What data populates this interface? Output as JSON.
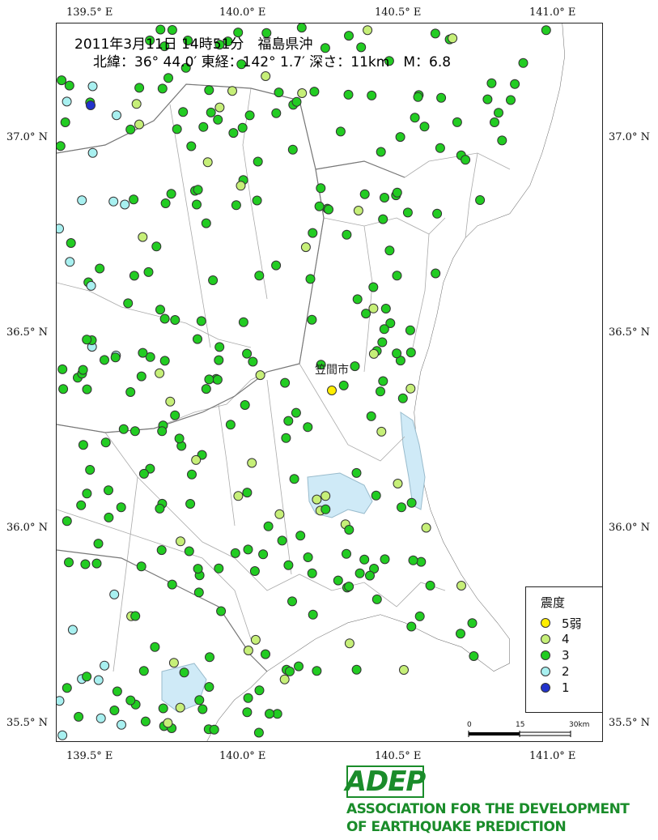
{
  "header": {
    "line1": "2011年3月11日 14時51分　福島県沖",
    "line2": "北緯：36° 44.0′ 東経：142° 1.7′ 深さ：11km　M：6.8"
  },
  "axes": {
    "top": [
      "139.5° E",
      "140.0° E",
      "140.5° E",
      "141.0° E"
    ],
    "bottom": [
      "139.5° E",
      "140.0° E",
      "140.5° E",
      "141.0° E"
    ],
    "left": [
      "37.0° N",
      "36.5° N",
      "36.0° N",
      "35.5° N"
    ],
    "right": [
      "37.0° N",
      "36.5° N",
      "36.0° N",
      "35.5° N"
    ]
  },
  "city_label": "笠間市",
  "legend": {
    "title": "震度",
    "items": [
      {
        "label": "5弱",
        "color": "#ffee00"
      },
      {
        "label": "4",
        "color": "#c6ef78"
      },
      {
        "label": "3",
        "color": "#22cc22"
      },
      {
        "label": "2",
        "color": "#a8f0f0"
      },
      {
        "label": "1",
        "color": "#2233cc"
      }
    ]
  },
  "scale": {
    "labels": [
      "0",
      "15",
      "30km"
    ]
  },
  "logo": {
    "mark": "ADEP",
    "line1": "ASSOCIATION FOR THE DEVELOPMENT",
    "line2": "OF EARTHQUAKE PREDICTION"
  },
  "colors": {
    "ocean": "#ffffff",
    "lake": "#cfeaf7",
    "border": "#999999",
    "dot3": "#22cc22"
  }
}
